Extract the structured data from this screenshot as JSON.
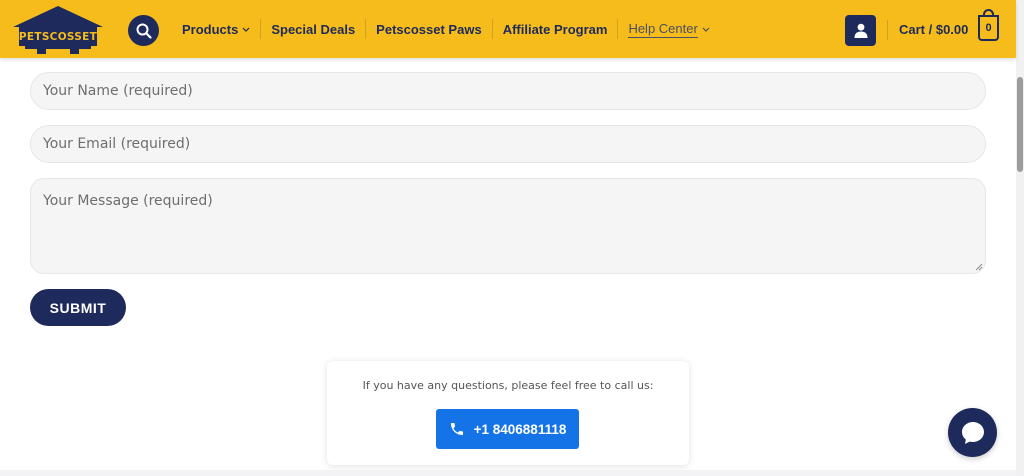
{
  "brand": {
    "name": "PETSCOSSET",
    "accent": "#f6bc1c",
    "navy": "#1d2a5b"
  },
  "nav": {
    "items": [
      {
        "label": "Products",
        "has_dropdown": true
      },
      {
        "label": "Special Deals",
        "has_dropdown": false
      },
      {
        "label": "Petscosset Paws",
        "has_dropdown": false
      },
      {
        "label": "Affiliate Program",
        "has_dropdown": false
      },
      {
        "label": "Help Center",
        "has_dropdown": true
      }
    ],
    "search_icon": "search-icon",
    "account_icon": "user-icon"
  },
  "cart": {
    "label": "Cart / $0.00",
    "count": "0"
  },
  "form": {
    "name_placeholder": "Your Name (required)",
    "email_placeholder": "Your Email (required)",
    "message_placeholder": "Your Message (required)",
    "submit_label": "SUBMIT"
  },
  "call": {
    "text": "If you have any questions, please feel free to call us:",
    "phone": "+1 8406881118",
    "button_color": "#1473e6"
  },
  "chat": {
    "icon": "chat-bubble-icon"
  }
}
